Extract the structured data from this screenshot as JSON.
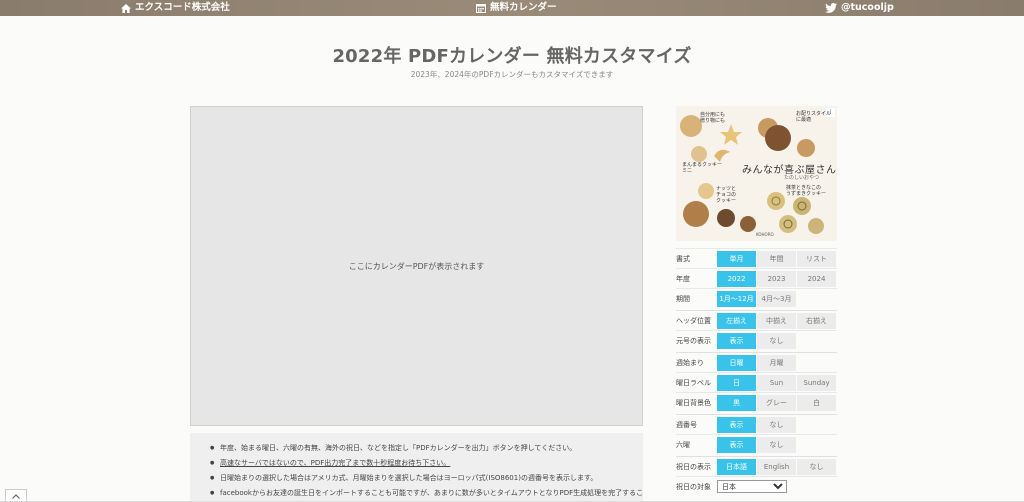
{
  "topbar": {
    "company": "エクスコード株式会社",
    "calendar": "無料カレンダー",
    "twitter": "@tucooljp"
  },
  "header": {
    "title": "2022年 PDFカレンダー 無料カスタマイズ",
    "subtitle": "2023年、2024年のPDFカレンダーもカスタマイズできます"
  },
  "preview": {
    "placeholder": "ここにカレンダーPDFが表示されます"
  },
  "notes": [
    "年度、始まる曜日、六曜の有無、海外の祝日、などを指定し「PDFカレンダーを出力」ボタンを押してください。",
    "高速なサーバではないので、PDF出力完了まで数十秒程度お待ち下さい。",
    "日曜始まりの選択した場合はアメリカ式、月曜始まりを選択した場合はヨーロッパ式(ISO8601)の週番号を表示します。",
    "facebookからお友達の誕生日をインポートすることも可能ですが、あまりに数が多いとタイムアウトとなりPDF生成処理を完了するこ"
  ],
  "ad": {
    "badge": "i",
    "headline": "みんなが喜ぶ屋さん",
    "tagline": "たのしいおやつ",
    "blurb1": "自分用にも\n贈り物にも",
    "blurb2": "お配りスタイル\nに最適",
    "blurb3": "まんまるクッキー\nミニ",
    "blurb4": "ナッツと\nチョコの\nクッキー",
    "blurb5": "抹茶ときなこの\nうずまきクッキー",
    "brand": "KOHORO"
  },
  "settings": {
    "rows": [
      {
        "label": "書式",
        "options": [
          "単月",
          "年間",
          "リスト"
        ],
        "selected": 0
      },
      {
        "label": "年度",
        "options": [
          "2022",
          "2023",
          "2024"
        ],
        "selected": 0
      },
      {
        "label": "期間",
        "options": [
          "1月～12月",
          "4月～3月"
        ],
        "selected": 0
      },
      {
        "label": "ヘッダ位置",
        "options": [
          "左揃え",
          "中揃え",
          "右揃え"
        ],
        "selected": 0
      },
      {
        "label": "元号の表示",
        "options": [
          "表示",
          "なし"
        ],
        "selected": 0
      },
      {
        "label": "週始まり",
        "options": [
          "日曜",
          "月曜"
        ],
        "selected": 0
      },
      {
        "label": "曜日ラベル",
        "options": [
          "日",
          "Sun",
          "Sunday"
        ],
        "selected": 0
      },
      {
        "label": "曜日背景色",
        "options": [
          "黒",
          "グレー",
          "白"
        ],
        "selected": 0
      },
      {
        "label": "週番号",
        "options": [
          "表示",
          "なし"
        ],
        "selected": 0
      },
      {
        "label": "六曜",
        "options": [
          "表示",
          "なし"
        ],
        "selected": 0
      },
      {
        "label": "祝日の表示",
        "options": [
          "日本語",
          "English",
          "なし"
        ],
        "selected": 0
      }
    ],
    "holiday_target": {
      "label": "祝日の対象",
      "value": "日本"
    }
  },
  "colors": {
    "accent": "#39c3ea",
    "topbar": "#8f8170",
    "preview_bg": "#e6e6e6"
  }
}
